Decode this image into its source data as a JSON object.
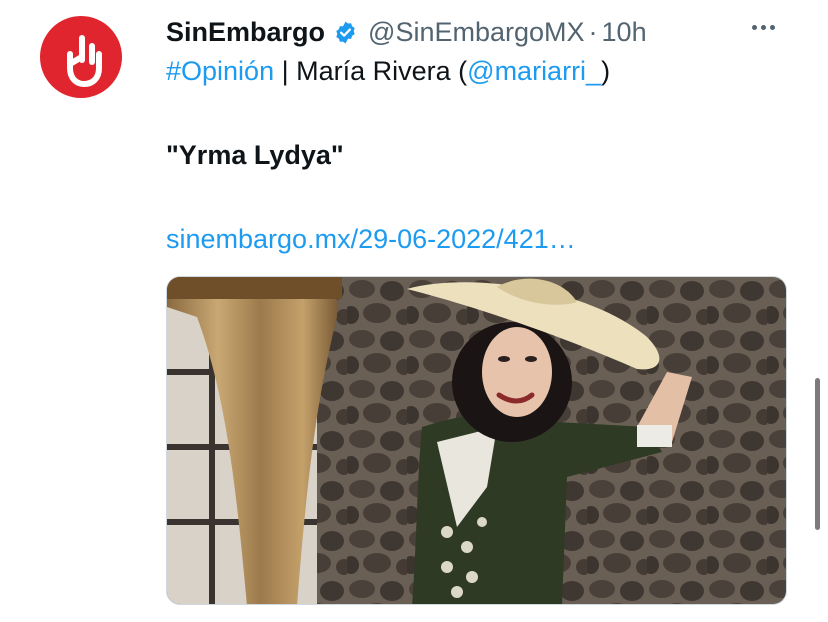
{
  "tweet": {
    "author_name": "SinEmbargo",
    "author_handle": "@SinEmbargoMX",
    "separator": "·",
    "time": "10h",
    "hashtag": "#Opinión",
    "byline_sep": " | María Rivera (",
    "mention": "@mariarri_",
    "byline_close": ")",
    "title": "\"Yrma Lydya\"",
    "link_text": "sinembargo.mx/29-06-2022/421…"
  },
  "icons": {
    "avatar": "sinembargo-logo",
    "verified": "verified-badge-icon",
    "more": "more-options-icon"
  },
  "colors": {
    "brand": "#e1252e",
    "link": "#1d9bf0",
    "secondary_text": "#536471",
    "verified": "#1d9bf0"
  }
}
